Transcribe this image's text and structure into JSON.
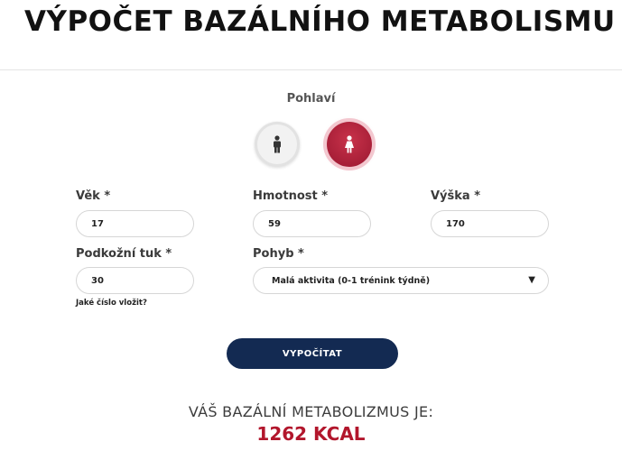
{
  "page": {
    "title": "VÝPOČET BAZÁLNÍHO METABOLISMU"
  },
  "gender": {
    "label": "Pohlaví",
    "options": [
      {
        "value": "male",
        "icon": "male-person-icon",
        "selected": false
      },
      {
        "value": "female",
        "icon": "female-person-icon",
        "selected": true
      }
    ]
  },
  "form": {
    "age": {
      "label": "Věk *",
      "value": "17"
    },
    "weight": {
      "label": "Hmotnost *",
      "value": "59"
    },
    "height": {
      "label": "Výška *",
      "value": "170"
    },
    "body_fat": {
      "label": "Podkožní tuk *",
      "value": "30",
      "help_link": "Jaké číslo vložit?"
    },
    "activity": {
      "label": "Pohyb *",
      "value": "Malá aktivita (0-1 trénink týdně)"
    }
  },
  "actions": {
    "calculate_label": "VYPOČÍTAT"
  },
  "result": {
    "label": "VÁŠ BAZÁLNÍ METABOLIZMUS JE:",
    "value": "1262 KCAL"
  },
  "colors": {
    "accent": "#b2162c",
    "button": "#132a52",
    "female_selected": "#b01f38"
  }
}
